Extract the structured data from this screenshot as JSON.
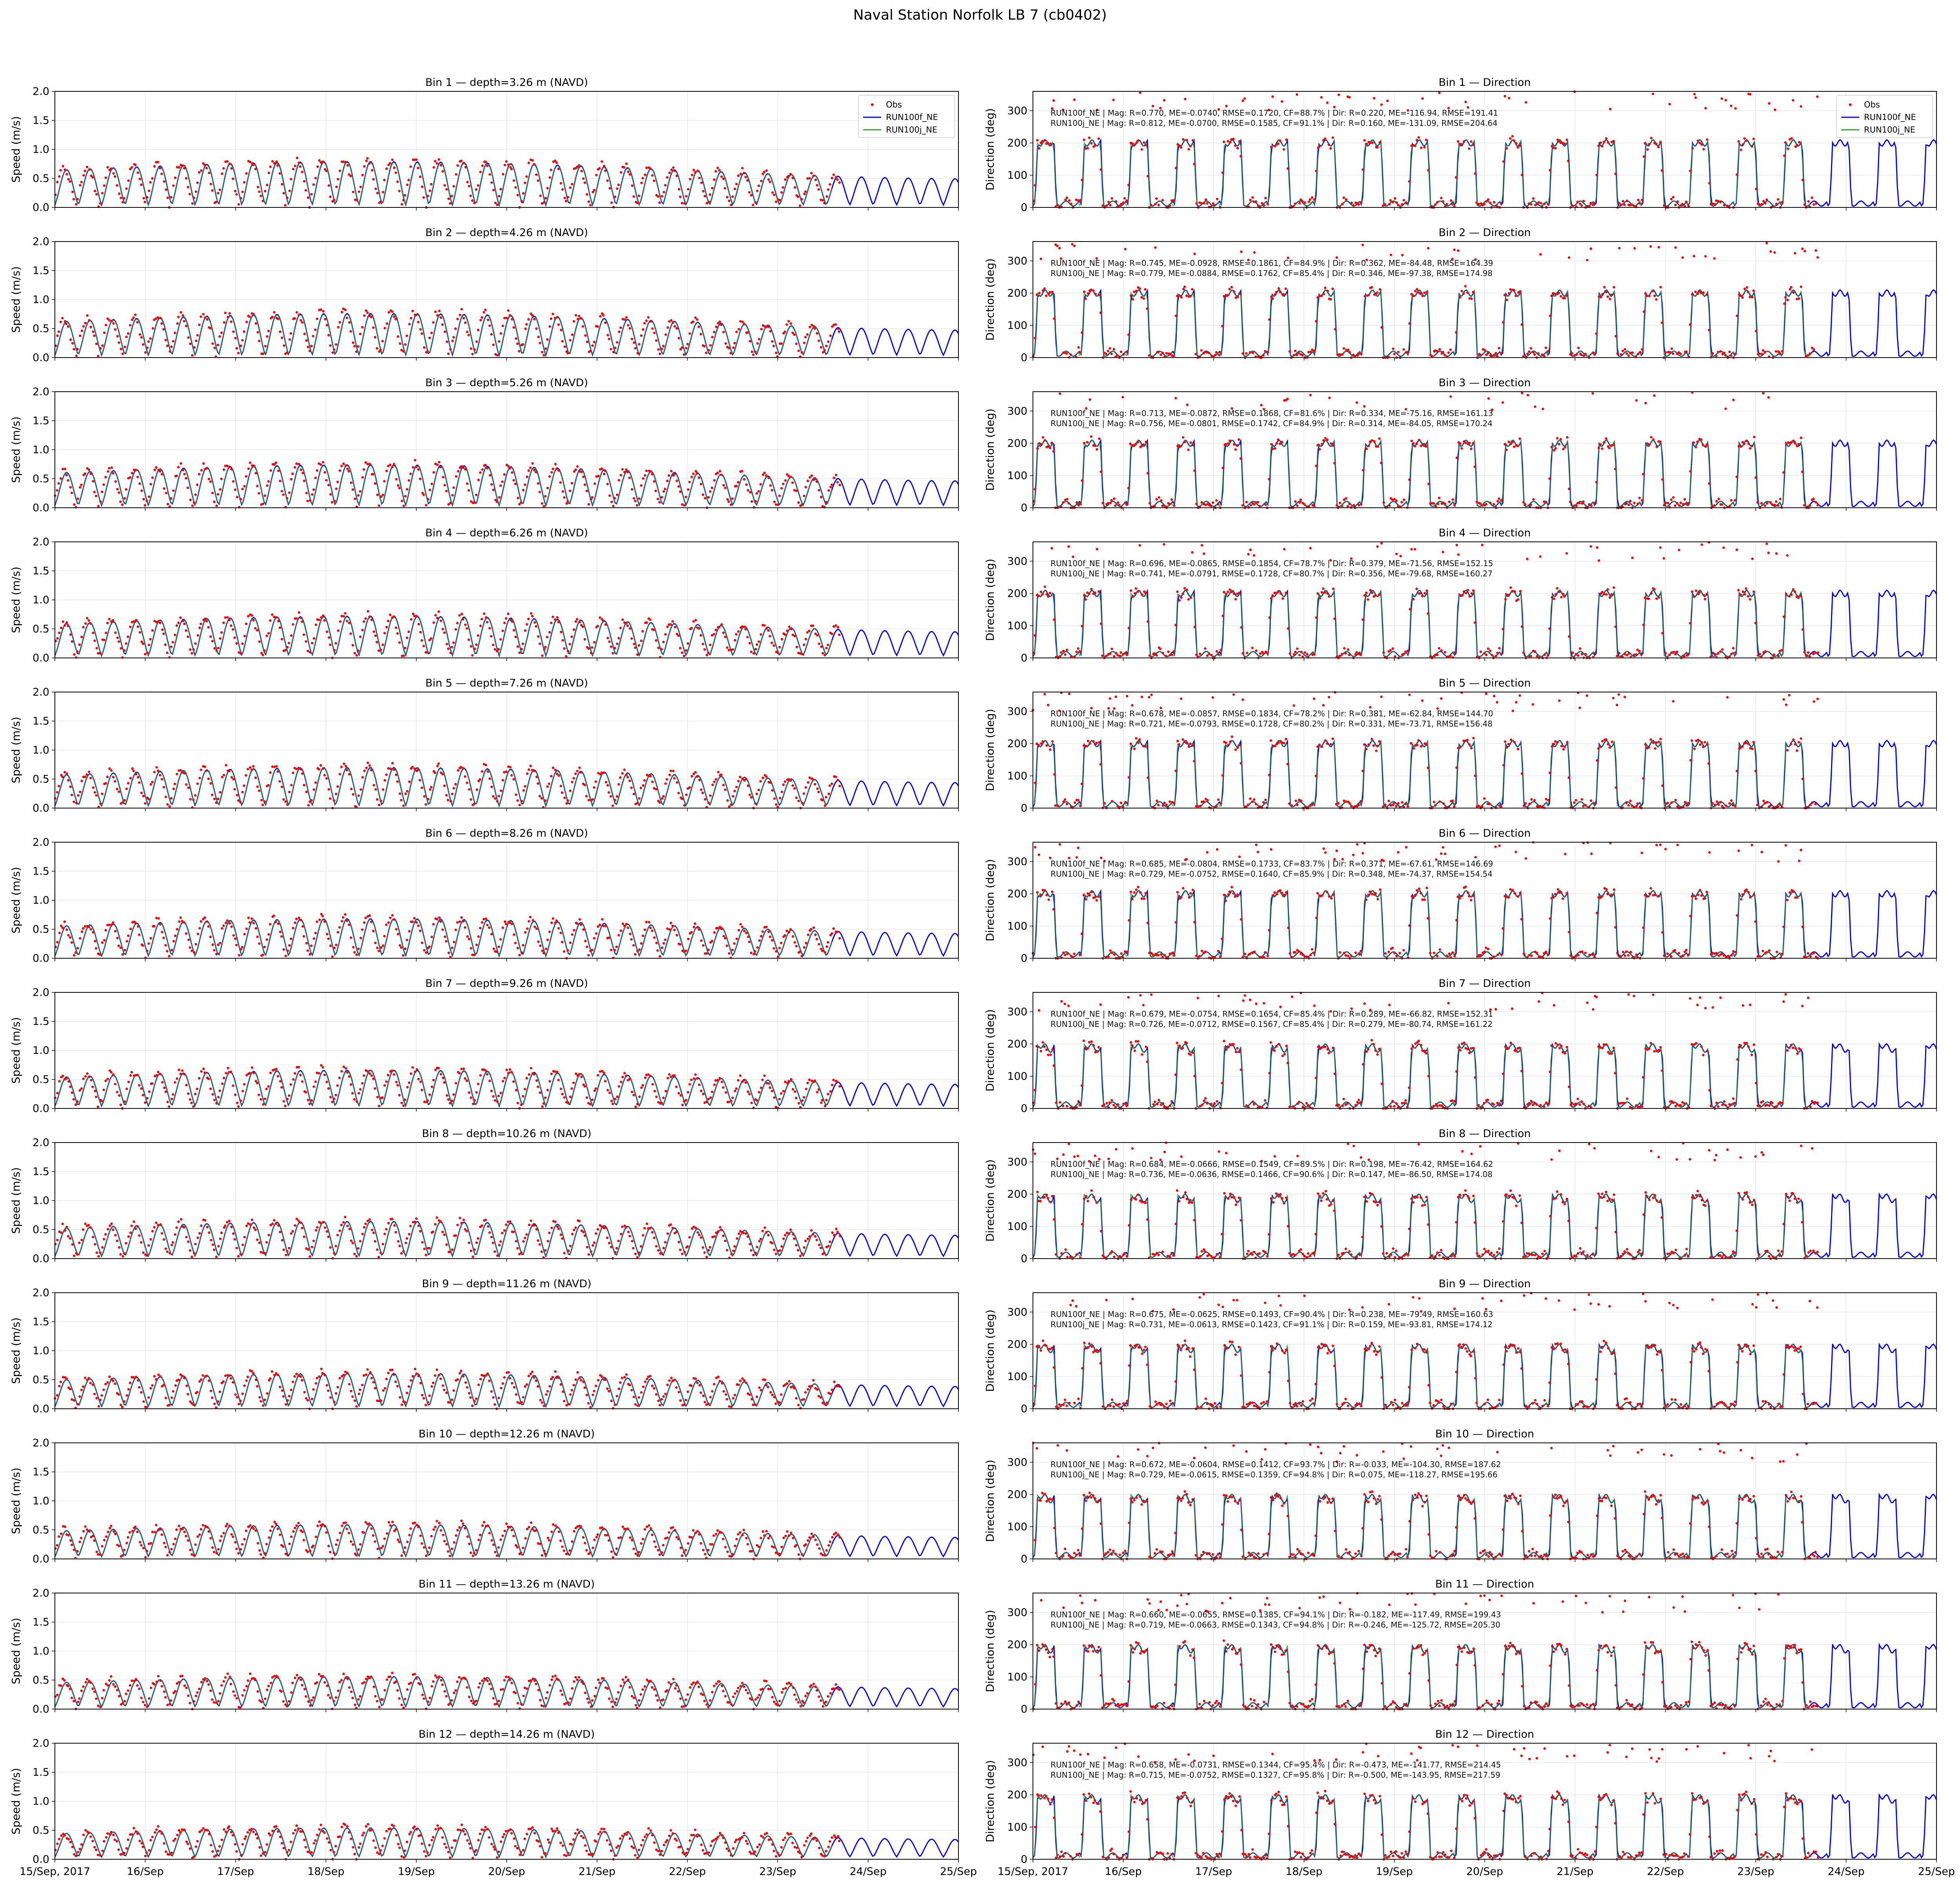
{
  "figure": {
    "title": "Naval Station Norfolk LB 7 (cb0402)"
  },
  "legend": [
    {
      "label": "Obs",
      "kind": "marker",
      "color": "#ff0000"
    },
    {
      "label": "RUN100f_NE",
      "kind": "line",
      "color": "#0000ff"
    },
    {
      "label": "RUN100j_NE",
      "kind": "line",
      "color": "#2ca02c"
    }
  ],
  "x_ticks": [
    "15/Sep, 2017",
    "16/Sep",
    "17/Sep",
    "18/Sep",
    "19/Sep",
    "20/Sep",
    "21/Sep",
    "22/Sep",
    "23/Sep",
    "24/Sep",
    "25/Sep"
  ],
  "chart_data": {
    "type": "line",
    "layout": "12 rows x 2 columns",
    "x_range": [
      "2017-09-15",
      "2017-09-25"
    ],
    "speed_axis": {
      "ylabel": "Speed (m/s)",
      "ylim": [
        0,
        2.0
      ],
      "yticks": [
        "0.0",
        "0.5",
        "1.0",
        "1.5",
        "2.0"
      ]
    },
    "direction_axis": {
      "ylabel": "Direction (deg)",
      "ylim": [
        0,
        360
      ],
      "yticks": [
        "0",
        "100",
        "200",
        "300"
      ]
    },
    "grid": true,
    "legend_position": "top-right of Bin 1 panels",
    "series_names": [
      "Obs",
      "RUN100f_NE",
      "RUN100j_NE"
    ],
    "tidal_period_hours": 12.42,
    "bins": [
      {
        "bin": 1,
        "speed_title": "Bin 1 — depth=3.26 m (NAVD)",
        "dir_title": "Bin 1 — Direction",
        "peak_speed": 0.75,
        "stats": [
          "RUN100f_NE | Mag: R=0.770, ME=-0.0740, RMSE=0.1720, CF=88.7% | Dir: R=0.220, ME=-116.94, RMSE=191.41",
          "RUN100j_NE | Mag: R=0.812, ME=-0.0700, RMSE=0.1585, CF=91.1% | Dir: R=0.160, ME=-131.09, RMSE=204.64"
        ]
      },
      {
        "bin": 2,
        "speed_title": "Bin 2 — depth=4.26 m (NAVD)",
        "dir_title": "Bin 2 — Direction",
        "peak_speed": 0.72,
        "stats": [
          "RUN100f_NE | Mag: R=0.745, ME=-0.0928, RMSE=0.1861, CF=84.9% | Dir: R=0.362, ME=-84.48, RMSE=164.39",
          "RUN100j_NE | Mag: R=0.779, ME=-0.0884, RMSE=0.1762, CF=85.4% | Dir: R=0.346, ME=-97.38, RMSE=174.98"
        ]
      },
      {
        "bin": 3,
        "speed_title": "Bin 3 — depth=5.26 m (NAVD)",
        "dir_title": "Bin 3 — Direction",
        "peak_speed": 0.7,
        "stats": [
          "RUN100f_NE | Mag: R=0.713, ME=-0.0872, RMSE=0.1868, CF=81.6% | Dir: R=0.334, ME=-75.16, RMSE=161.13",
          "RUN100j_NE | Mag: R=0.756, ME=-0.0801, RMSE=0.1742, CF=84.9% | Dir: R=0.314, ME=-84.05, RMSE=170.24"
        ]
      },
      {
        "bin": 4,
        "speed_title": "Bin 4 — depth=6.26 m (NAVD)",
        "dir_title": "Bin 4 — Direction",
        "peak_speed": 0.68,
        "stats": [
          "RUN100f_NE | Mag: R=0.696, ME=-0.0865, RMSE=0.1854, CF=78.7% | Dir: R=0.379, ME=-71.56, RMSE=152.15",
          "RUN100j_NE | Mag: R=0.741, ME=-0.0791, RMSE=0.1728, CF=80.7% | Dir: R=0.356, ME=-79.68, RMSE=160.27"
        ]
      },
      {
        "bin": 5,
        "speed_title": "Bin 5 — depth=7.26 m (NAVD)",
        "dir_title": "Bin 5 — Direction",
        "peak_speed": 0.66,
        "stats": [
          "RUN100f_NE | Mag: R=0.678, ME=-0.0857, RMSE=0.1834, CF=78.2% | Dir: R=0.381, ME=-62.84, RMSE=144.70",
          "RUN100j_NE | Mag: R=0.721, ME=-0.0793, RMSE=0.1728, CF=80.2% | Dir: R=0.331, ME=-73.71, RMSE=156.48"
        ]
      },
      {
        "bin": 6,
        "speed_title": "Bin 6 — depth=8.26 m (NAVD)",
        "dir_title": "Bin 6 — Direction",
        "peak_speed": 0.64,
        "stats": [
          "RUN100f_NE | Mag: R=0.685, ME=-0.0804, RMSE=0.1733, CF=83.7% | Dir: R=0.371, ME=-67.61, RMSE=146.69",
          "RUN100j_NE | Mag: R=0.729, ME=-0.0752, RMSE=0.1640, CF=85.9% | Dir: R=0.348, ME=-74.37, RMSE=154.54"
        ]
      },
      {
        "bin": 7,
        "speed_title": "Bin 7 — depth=9.26 m (NAVD)",
        "dir_title": "Bin 7 — Direction",
        "peak_speed": 0.62,
        "stats": [
          "RUN100f_NE | Mag: R=0.679, ME=-0.0754, RMSE=0.1654, CF=85.4% | Dir: R=0.289, ME=-66.82, RMSE=152.31",
          "RUN100j_NE | Mag: R=0.726, ME=-0.0712, RMSE=0.1567, CF=85.4% | Dir: R=0.279, ME=-80.74, RMSE=161.22"
        ]
      },
      {
        "bin": 8,
        "speed_title": "Bin 8 — depth=10.26 m (NAVD)",
        "dir_title": "Bin 8 — Direction",
        "peak_speed": 0.6,
        "stats": [
          "RUN100f_NE | Mag: R=0.684, ME=-0.0666, RMSE=0.1549, CF=89.5% | Dir: R=0.198, ME=-76.42, RMSE=164.62",
          "RUN100j_NE | Mag: R=0.736, ME=-0.0636, RMSE=0.1466, CF=90.6% | Dir: R=0.147, ME=-86.50, RMSE=174.08"
        ]
      },
      {
        "bin": 9,
        "speed_title": "Bin 9 — depth=11.26 m (NAVD)",
        "dir_title": "Bin 9 — Direction",
        "peak_speed": 0.57,
        "stats": [
          "RUN100f_NE | Mag: R=0.675, ME=-0.0625, RMSE=0.1493, CF=90.4% | Dir: R=0.238, ME=-79.49, RMSE=160.63",
          "RUN100j_NE | Mag: R=0.731, ME=-0.0613, RMSE=0.1423, CF=91.1% | Dir: R=0.159, ME=-93.81, RMSE=174.12"
        ]
      },
      {
        "bin": 10,
        "speed_title": "Bin 10 — depth=12.26 m (NAVD)",
        "dir_title": "Bin 10 — Direction",
        "peak_speed": 0.55,
        "stats": [
          "RUN100f_NE | Mag: R=0.672, ME=-0.0604, RMSE=0.1412, CF=93.7% | Dir: R=-0.033, ME=-104.30, RMSE=187.62",
          "RUN100j_NE | Mag: R=0.729, ME=-0.0615, RMSE=0.1359, CF=94.8% | Dir: R=0.075, ME=-118.27, RMSE=195.66"
        ]
      },
      {
        "bin": 11,
        "speed_title": "Bin 11 — depth=13.26 m (NAVD)",
        "dir_title": "Bin 11 — Direction",
        "peak_speed": 0.52,
        "stats": [
          "RUN100f_NE | Mag: R=0.660, ME=-0.0655, RMSE=0.1385, CF=94.1% | Dir: R=-0.182, ME=-117.49, RMSE=199.43",
          "RUN100j_NE | Mag: R=0.719, ME=-0.0663, RMSE=0.1343, CF=94.8% | Dir: R=-0.246, ME=-125.72, RMSE=205.30"
        ]
      },
      {
        "bin": 12,
        "speed_title": "Bin 12 — depth=14.26 m (NAVD)",
        "dir_title": "Bin 12 — Direction",
        "peak_speed": 0.5,
        "stats": [
          "RUN100f_NE | Mag: R=0.658, ME=-0.0731, RMSE=0.1344, CF=95.4% | Dir: R=-0.473, ME=-141.77, RMSE=214.45",
          "RUN100j_NE | Mag: R=0.715, ME=-0.0752, RMSE=0.1327, CF=95.8% | Dir: R=-0.500, ME=-143.95, RMSE=217.59"
        ]
      }
    ]
  }
}
